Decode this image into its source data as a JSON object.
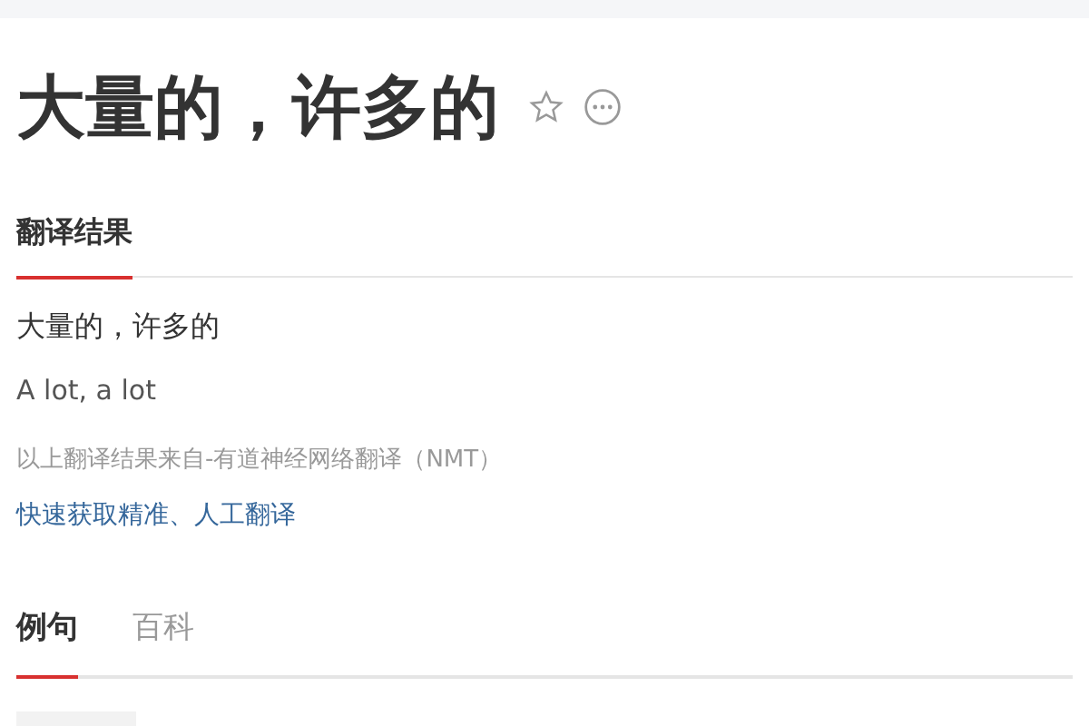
{
  "title": "大量的，许多的",
  "result_tabs": [
    {
      "label": "翻译结果",
      "selected": true
    }
  ],
  "translation": {
    "source": "大量的，许多的",
    "target": "A lot, a lot",
    "attribution": "以上翻译结果来自-有道神经网络翻译（NMT）",
    "link": "快速获取精准、人工翻译"
  },
  "section_tabs": [
    {
      "label": "例句",
      "selected": true
    },
    {
      "label": "百科",
      "selected": false
    }
  ]
}
